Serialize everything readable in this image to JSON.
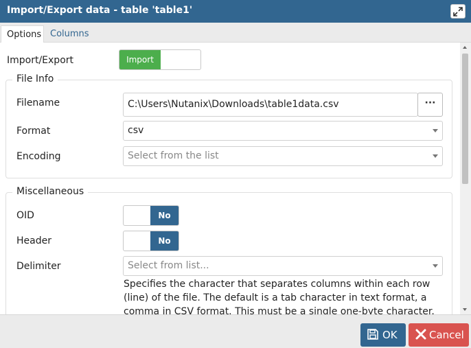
{
  "window": {
    "title": "Import/Export data - table 'table1'"
  },
  "tabs": [
    {
      "label": "Options"
    },
    {
      "label": "Columns"
    }
  ],
  "options": {
    "import_export": {
      "label": "Import/Export",
      "value": "Import"
    },
    "file_info": {
      "legend": "File Info",
      "filename": {
        "label": "Filename",
        "value": "C:\\Users\\Nutanix\\Downloads\\table1data.csv",
        "browse_label": "···"
      },
      "format": {
        "label": "Format",
        "value": "csv"
      },
      "encoding": {
        "label": "Encoding",
        "placeholder": "Select from the list"
      }
    },
    "misc": {
      "legend": "Miscellaneous",
      "oid": {
        "label": "OID",
        "value": "No"
      },
      "header": {
        "label": "Header",
        "value": "No"
      },
      "delimiter": {
        "label": "Delimiter",
        "placeholder": "Select from list...",
        "help": "Specifies the character that separates columns within each row (line) of the file. The default is a tab character in text format, a comma in CSV format. This must be a single one-byte character. This option is not"
      }
    }
  },
  "footer": {
    "ok_label": "OK",
    "cancel_label": "Cancel"
  },
  "colors": {
    "accent": "#326690",
    "success": "#4cae4c",
    "danger": "#d9534f"
  },
  "icons": {
    "maximize": "expand-arrows-icon",
    "ok": "save-icon",
    "cancel": "close-x-icon"
  }
}
